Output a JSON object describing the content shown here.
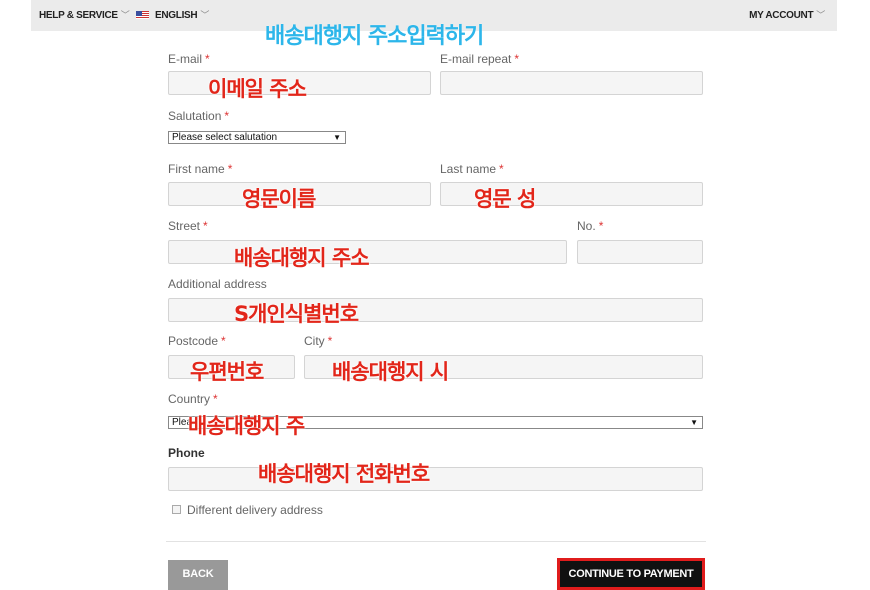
{
  "header": {
    "help_label": "HELP & SERVICE",
    "language_label": "ENGLISH",
    "account_label": "MY ACCOUNT",
    "chevron": "﹀"
  },
  "overlay_title": "배송대행지 주소입력하기",
  "form": {
    "email_label": "E-mail",
    "email_repeat_label": "E-mail repeat",
    "salutation_label": "Salutation",
    "salutation_value": "Please select salutation",
    "first_name_label": "First name",
    "last_name_label": "Last name",
    "street_label": "Street",
    "number_label": "No.",
    "additional_label": "Additional address",
    "postcode_label": "Postcode",
    "city_label": "City",
    "country_label": "Country",
    "country_value": "Plea",
    "phone_label": "Phone",
    "delivery_label": "Different delivery address",
    "required_mark": "*"
  },
  "annotations": {
    "email": "이메일 주소",
    "first_name": "영문이름",
    "last_name": "영문 성",
    "street": "배송대행지 주소",
    "additional": "S개인식별번호",
    "postcode": "우편번호",
    "city": "배송대행지 시",
    "country": "배송대행지 주",
    "phone": "배송대행지 전화번호"
  },
  "buttons": {
    "back": "BACK",
    "continue": "CONTINUE TO PAYMENT"
  },
  "colors": {
    "annotation": "#e2261a",
    "title_overlay": "#2db6ea",
    "highlight_border": "#e01c1c"
  }
}
